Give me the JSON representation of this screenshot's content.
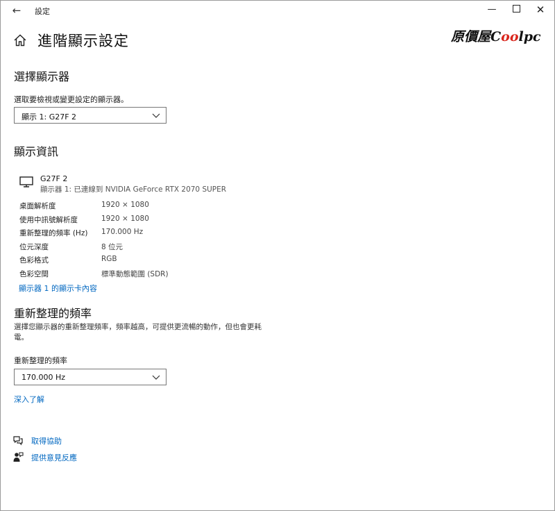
{
  "window": {
    "title": "設定",
    "back_glyph": "←",
    "min_glyph": "—",
    "close_glyph": "✕"
  },
  "page": {
    "title": "進階顯示設定",
    "logo_prefix": "原價屋",
    "logo_c": "C",
    "logo_loop": "oo",
    "logo_suffix": "lpc"
  },
  "select_display": {
    "heading": "選擇顯示器",
    "label": "選取要檢視或變更設定的顯示器。",
    "selected": "顯示 1: G27F 2"
  },
  "display_info": {
    "heading": "顯示資訊",
    "monitor_name": "G27F 2",
    "monitor_sub": "顯示器 1: 已連線到 NVIDIA GeForce RTX 2070 SUPER",
    "rows": [
      {
        "key": "桌面解析度",
        "value": "1920 × 1080"
      },
      {
        "key": "使用中訊號解析度",
        "value": "1920 × 1080"
      },
      {
        "key": "重新整理的頻率 (Hz)",
        "value": "170.000 Hz"
      },
      {
        "key": "位元深度",
        "value": "8 位元"
      },
      {
        "key": "色彩格式",
        "value": "RGB"
      },
      {
        "key": "色彩空間",
        "value": "標準動態範圍 (SDR)"
      }
    ],
    "adapter_link": "顯示器 1 的顯示卡內容"
  },
  "refresh": {
    "heading": "重新整理的頻率",
    "description": "選擇您顯示器的重新整理頻率，頻率越高，可提供更流暢的動作，但也會更耗電。",
    "label": "重新整理的頻率",
    "selected": "170.000 Hz",
    "learn_more": "深入了解"
  },
  "footer": {
    "help": "取得協助",
    "feedback": "提供意見反應"
  },
  "colors": {
    "accent_link": "#0067c0",
    "logo_red": "#d9251c"
  }
}
